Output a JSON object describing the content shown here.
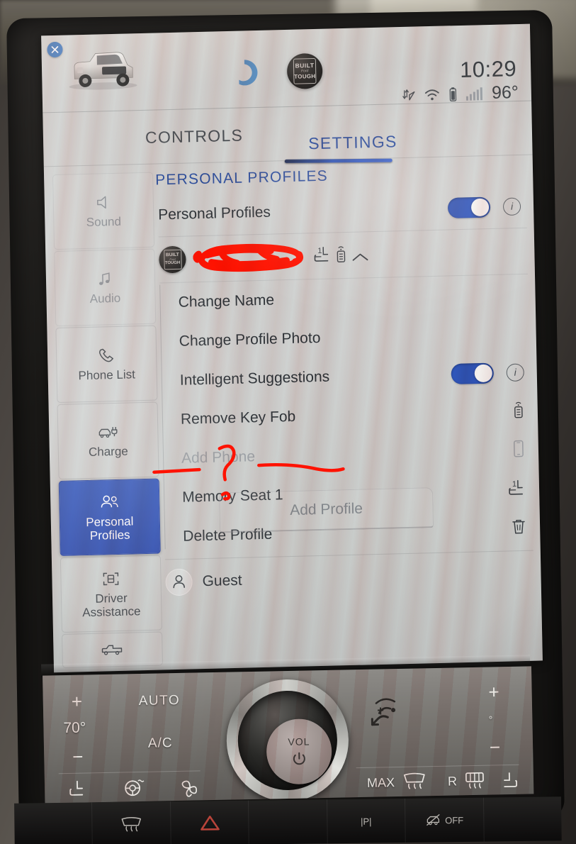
{
  "window": {
    "device": "Ford SYNC 4 center touchscreen",
    "close_icon": "close-icon"
  },
  "header": {
    "truck_icon": "pickup-truck-image",
    "alexa_icon": "alexa-ring-icon",
    "brand_badge": {
      "line1": "BUILT",
      "line2": "Ford",
      "line3": "TOUGH"
    },
    "clock": "10:29",
    "outside_temp": "96°",
    "status_icons": [
      "data-transfer-icon",
      "navigation-arrow-icon",
      "wifi-icon",
      "battery-icon",
      "signal-bars-icon"
    ]
  },
  "tabs": [
    {
      "label": "CONTROLS",
      "active": false
    },
    {
      "label": "SETTINGS",
      "active": true
    }
  ],
  "section": {
    "title": "PERSONAL PROFILES"
  },
  "sidebar": {
    "items": [
      {
        "label": "Sound",
        "icon": "speaker-icon",
        "state": "dim"
      },
      {
        "label": "Audio",
        "icon": "music-note-icon",
        "state": "dim"
      },
      {
        "label": "Phone List",
        "icon": "phone-handset-icon",
        "state": "normal"
      },
      {
        "label": "Charge",
        "icon": "car-charge-plug-icon",
        "state": "normal"
      },
      {
        "label": "Personal\nProfiles",
        "icon": "two-people-icon",
        "state": "active"
      },
      {
        "label": "Driver\nAssistance",
        "icon": "driver-assist-icon",
        "state": "normal"
      },
      {
        "label": "",
        "icon": "pickup-truck-icon",
        "state": "partial"
      }
    ],
    "active_label": "Personal Profiles"
  },
  "main": {
    "master_row": {
      "label": "Personal Profiles",
      "toggle_on": true,
      "info_icon": "info-icon"
    },
    "profile": {
      "avatar": "built-ford-tough-badge-avatar",
      "name_redacted": true,
      "name_placeholder": "",
      "icons": [
        "memory-seat-1-icon",
        "key-fob-icon",
        "chevron-up-icon"
      ],
      "expanded": true
    },
    "sub_items": [
      {
        "label": "Change Name",
        "icon": "",
        "disabled": false
      },
      {
        "label": "Change Profile Photo",
        "icon": "",
        "disabled": false
      },
      {
        "label": "Intelligent Suggestions",
        "icon": "toggle",
        "disabled": false,
        "toggle_on": true,
        "info_icon": "info-icon"
      },
      {
        "label": "Remove Key Fob",
        "icon": "key-fob-icon",
        "disabled": false
      },
      {
        "label": "Add Phone",
        "icon": "phone-device-icon",
        "disabled": true
      },
      {
        "label": "Memory Seat 1",
        "icon": "memory-seat-1-icon",
        "disabled": false
      },
      {
        "label": "Delete Profile",
        "icon": "trash-icon",
        "disabled": false
      }
    ],
    "guest": {
      "label": "Guest",
      "icon": "person-icon"
    },
    "add_profile_button": "Add Profile"
  },
  "annotations": {
    "color": "#ff1200",
    "marks": [
      {
        "type": "redaction-scribble",
        "target": "profile name"
      },
      {
        "type": "underline",
        "target": "Add Phone label"
      },
      {
        "type": "question-mark",
        "symbol": "?"
      },
      {
        "type": "underline",
        "target": "phone icon"
      }
    ]
  },
  "climate": {
    "driver_temp": "70°",
    "plus": "+",
    "minus": "−",
    "auto": "AUTO",
    "ac": "A/C",
    "volume_label": "VOL",
    "max_defrost": "MAX",
    "rear_defrost": "R",
    "passenger_temp": "°",
    "icons": [
      "heated-seat-icon",
      "heated-steering-wheel-icon",
      "fan-icon",
      "front-defrost-icon",
      "rear-defrost-icon",
      "passenger-heated-seat-icon",
      "airflow-icon",
      "power-icon"
    ]
  },
  "hard_buttons": [
    {
      "label": "",
      "icon": "max-defrost-icon"
    },
    {
      "label": "",
      "icon": "hazard-triangle-icon",
      "color": "#b8443a"
    },
    {
      "label": "|P|",
      "icon": "parking-brake-icon"
    },
    {
      "label": "OFF",
      "icon": "traction-control-off-icon"
    }
  ]
}
